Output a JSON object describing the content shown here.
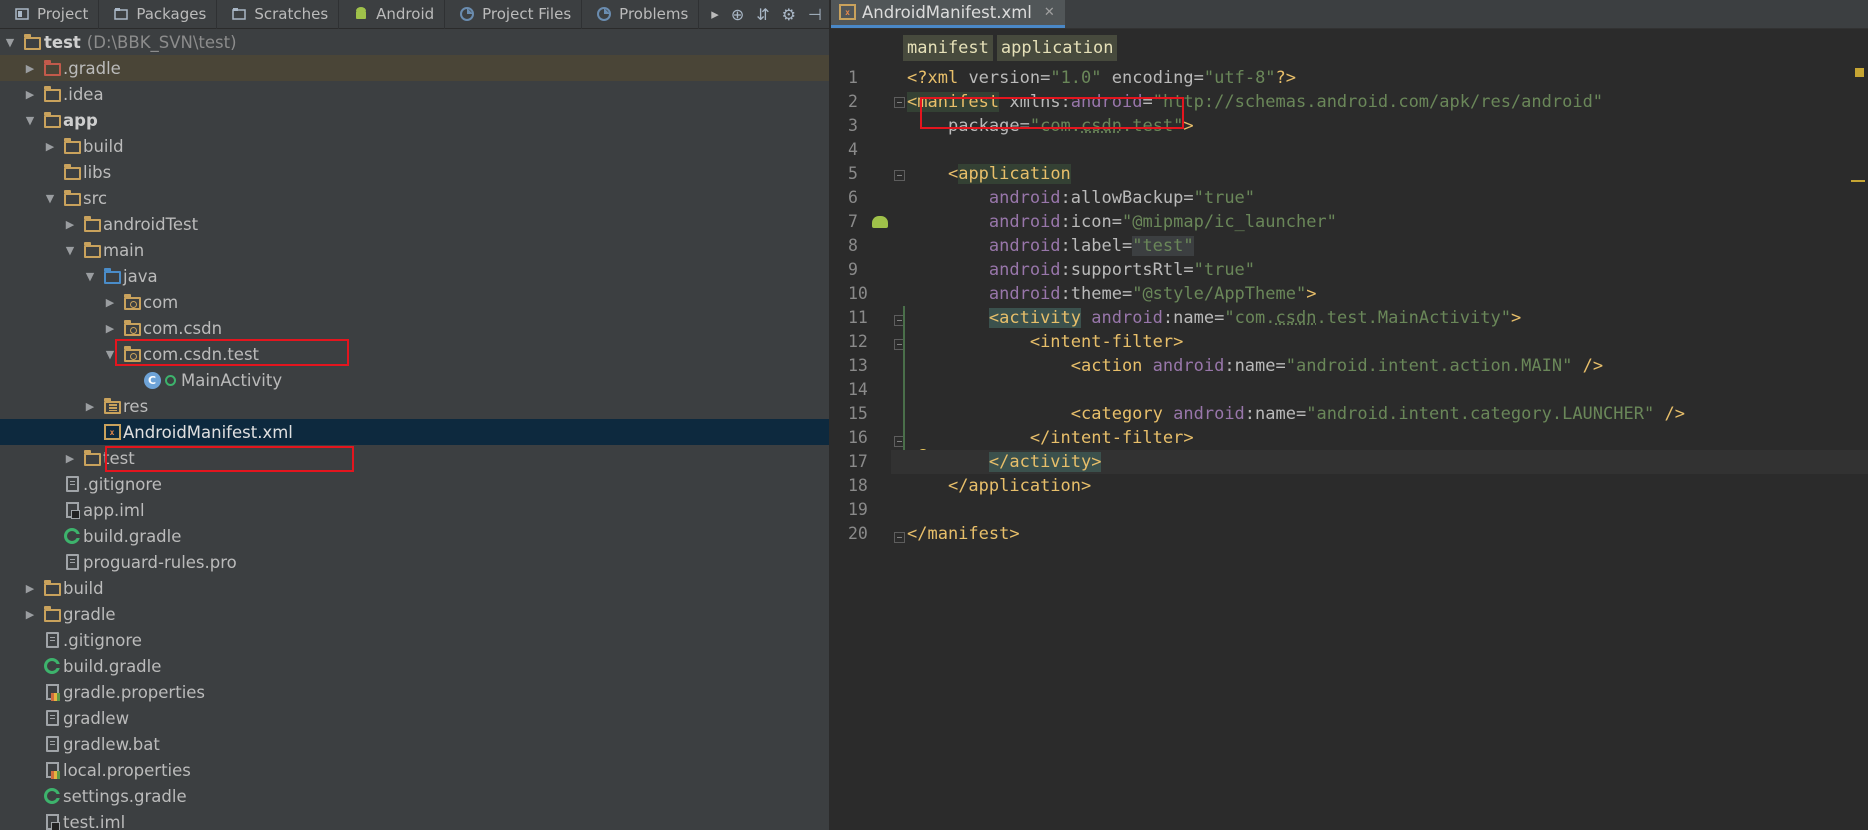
{
  "left_tabs": [
    {
      "label": "Project",
      "icon": "project-icon"
    },
    {
      "label": "Packages",
      "icon": "packages-icon"
    },
    {
      "label": "Scratches",
      "icon": "scratches-icon"
    },
    {
      "label": "Android",
      "icon": "android-icon"
    },
    {
      "label": "Project Files",
      "icon": "project-files-icon"
    },
    {
      "label": "Problems",
      "icon": "problems-icon"
    }
  ],
  "tree": {
    "root_name": "test",
    "root_path": "(D:\\BBK_SVN\\test)",
    "items": [
      {
        "label": "test"
      },
      {
        "label": ".gradle"
      },
      {
        "label": ".idea"
      },
      {
        "label": "app"
      },
      {
        "label": "build"
      },
      {
        "label": "libs"
      },
      {
        "label": "src"
      },
      {
        "label": "androidTest"
      },
      {
        "label": "main"
      },
      {
        "label": "java"
      },
      {
        "label": "com"
      },
      {
        "label": "com.csdn"
      },
      {
        "label": "com.csdn.test"
      },
      {
        "label": "MainActivity"
      },
      {
        "label": "res"
      },
      {
        "label": "AndroidManifest.xml"
      },
      {
        "label": "test"
      },
      {
        "label": ".gitignore"
      },
      {
        "label": "app.iml"
      },
      {
        "label": "build.gradle"
      },
      {
        "label": "proguard-rules.pro"
      },
      {
        "label": "build"
      },
      {
        "label": "gradle"
      },
      {
        "label": ".gitignore"
      },
      {
        "label": "build.gradle"
      },
      {
        "label": "gradle.properties"
      },
      {
        "label": "gradlew"
      },
      {
        "label": "gradlew.bat"
      },
      {
        "label": "local.properties"
      },
      {
        "label": "settings.gradle"
      },
      {
        "label": "test.iml"
      }
    ]
  },
  "editor": {
    "tab_label": "AndroidManifest.xml",
    "breadcrumbs": [
      "manifest",
      "application"
    ],
    "line_numbers": [
      "1",
      "2",
      "3",
      "4",
      "5",
      "6",
      "7",
      "8",
      "9",
      "10",
      "11",
      "12",
      "13",
      "14",
      "15",
      "16",
      "17",
      "18",
      "19",
      "20"
    ]
  },
  "colors": {
    "highlight_box": "#e4151e",
    "selection": "#0d293e",
    "xml_tag": "#e8bf6a",
    "xml_namespace": "#9876aa",
    "xml_value": "#6a8759"
  }
}
